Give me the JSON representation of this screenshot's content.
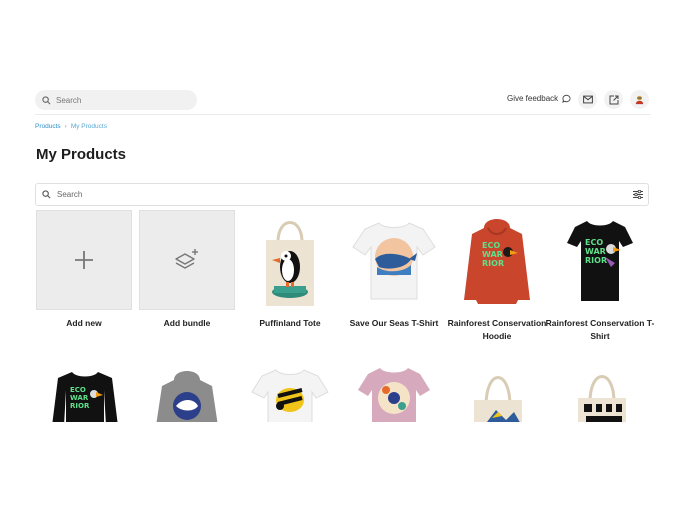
{
  "topbar": {
    "search_placeholder": "Search",
    "feedback_label": "Give feedback",
    "icons": [
      "search-icon",
      "chat-bubble-icon",
      "mail-icon",
      "external-link-icon",
      "avatar"
    ]
  },
  "breadcrumb": {
    "items": [
      {
        "label": "Products"
      },
      {
        "label": "My Products"
      }
    ],
    "separator": "›"
  },
  "page": {
    "title": "My Products",
    "search_placeholder": "Search"
  },
  "colors": {
    "accent_link": "#2a8fc9",
    "tile_grey": "#ececec",
    "hoodie_red": "#c9452c",
    "tee_black": "#111111",
    "tote_natural": "#ede3d2",
    "jumper_grey": "#8c8c8c",
    "tee_pink": "#d7a9bd"
  },
  "actions": {
    "add_new": "Add new",
    "add_bundle": "Add bundle"
  },
  "products": [
    {
      "name": "Puffinland Tote"
    },
    {
      "name": "Save Our Seas T-Shirt"
    },
    {
      "name": "Rainforest Conservation Hoodie"
    },
    {
      "name": "Rainforest Conservation T-Shirt"
    }
  ]
}
